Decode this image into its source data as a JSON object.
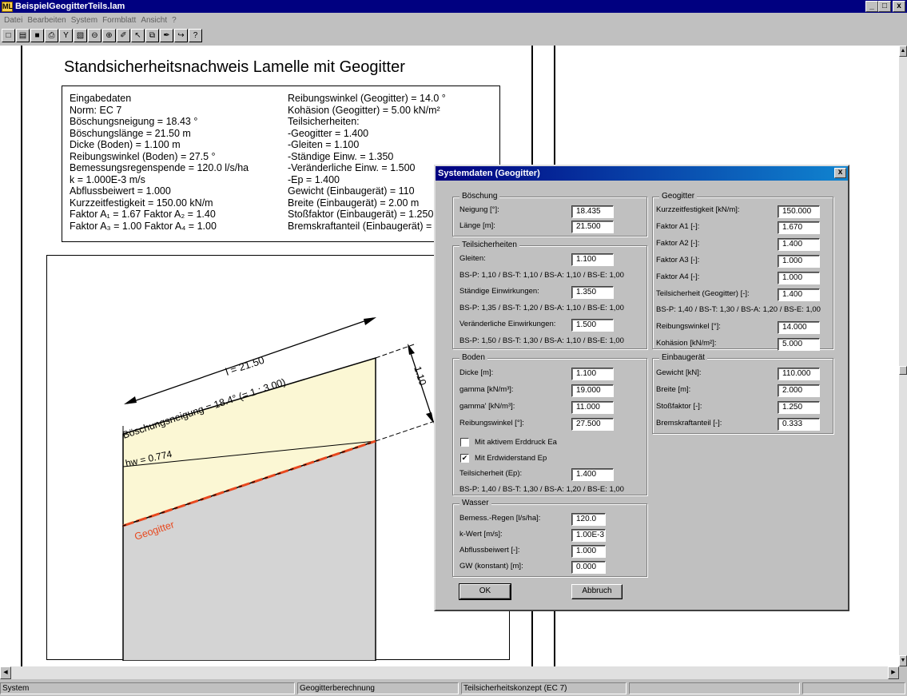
{
  "window": {
    "title": "BeispielGeogitterTeils.lam",
    "app_icon": "ML",
    "controls": [
      "_",
      "□",
      "x"
    ]
  },
  "menu": [
    "Datei",
    "Bearbeiten",
    "System",
    "Formblatt",
    "Ansicht",
    "?"
  ],
  "toolbar": [
    "new-icon",
    "open-icon",
    "save-icon",
    "print-icon",
    "filter-icon",
    "page-preview-icon",
    "zoom-out-icon",
    "zoom-in-icon",
    "edit-icon",
    "pointer-icon",
    "copy-icon",
    "paint-icon",
    "export-icon",
    "help-icon"
  ],
  "toolbar_glyphs": [
    "□",
    "▤",
    "■",
    "⎙",
    "Y",
    "▧",
    "⊖",
    "⊕",
    "✐",
    "↖",
    "⧉",
    "✒",
    "↪",
    "?"
  ],
  "document": {
    "title": "Standsicherheitsnachweis Lamelle mit Geogitter",
    "left_lines": [
      "Eingabedaten",
      "Norm:  EC 7",
      "Böschungsneigung  = 18.43 °",
      "Böschungslänge  = 21.50 m",
      "Dicke (Boden)  = 1.100 m",
      "Reibungswinkel (Boden) = 27.5 °",
      "Bemessungsregenspende = 120.0 l/s/ha",
      "k  =  1.000E-3 m/s",
      "Abflussbeiwert = 1.000",
      "Kurzzeitfestigkeit = 150.00 kN/m",
      "Faktor A₁ = 1.67  Faktor A₂ = 1.40",
      "Faktor A₃ = 1.00  Faktor A₄ = 1.00"
    ],
    "right_lines": [
      "Reibungswinkel (Geogitter) = 14.0 °",
      "Kohäsion (Geogitter) = 5.00 kN/m²",
      "Teilsicherheiten:",
      " -Geogitter = 1.400",
      " -Gleiten = 1.100",
      " -Ständige Einw. = 1.350",
      " -Veränderliche Einw. = 1.500",
      " -Ep = 1.400",
      "Gewicht (Einbaugerät) = 110",
      "Breite (Einbaugerät) = 2.00 m",
      "Stoßfaktor (Einbaugerät) = 1.250",
      "Bremskraftanteil (Einbaugerät) = 0.333"
    ],
    "drawing": {
      "length_label": "l = 21.50",
      "slope_label": "Böschungsneigung = 18.4° (= 1 : 3.00)",
      "thickness_label": "1.10",
      "hw_label": "hw = 0.774",
      "geogitter_label": "Geogitter",
      "colors": {
        "soil": "#fbf7d4",
        "base": "#d4d4d4",
        "geogitter": "#e8481e"
      }
    }
  },
  "dialog": {
    "title": "Systemdaten (Geogitter)",
    "close": "x",
    "boeschung": {
      "title": "Böschung",
      "neigung_label": "Neigung [°]:",
      "neigung": "18.435",
      "laenge_label": "Länge [m]:",
      "laenge": "21.500"
    },
    "teilsicherheiten": {
      "title": "Teilsicherheiten",
      "gleiten_label": "Gleiten:",
      "gleiten": "1.100",
      "gleiten_note": "BS-P: 1,10 / BS-T: 1,10 / BS-A: 1,10 / BS-E: 1,00",
      "staendig_label": "Ständige Einwirkungen:",
      "staendig": "1.350",
      "staendig_note": "BS-P: 1,35 / BS-T: 1,20 / BS-A: 1,10 / BS-E: 1,00",
      "veraenderlich_label": "Veränderliche Einwirkungen:",
      "veraenderlich": "1.500",
      "veraenderlich_note": "BS-P: 1,50 / BS-T: 1,30 / BS-A: 1,10 / BS-E: 1,00"
    },
    "boden": {
      "title": "Boden",
      "dicke_label": "Dicke [m]:",
      "dicke": "1.100",
      "gamma_label": "gamma [kN/m³]:",
      "gamma": "19.000",
      "gamma2_label": "gamma' [kN/m³]:",
      "gamma2": "11.000",
      "reibung_label": "Reibungswinkel [°]:",
      "reibung": "27.500",
      "aktiv_label": "Mit aktivem Erddruck Ea",
      "aktiv_checked": false,
      "widerstand_label": "Mit Erdwiderstand Ep",
      "widerstand_checked": true,
      "teilsicherheit_label": "Teilsicherheit (Ep):",
      "teilsicherheit": "1.400",
      "note": "BS-P: 1,40 / BS-T: 1,30 / BS-A: 1,20 / BS-E: 1,00"
    },
    "wasser": {
      "title": "Wasser",
      "regen_label": "Bemess.-Regen [l/s/ha]:",
      "regen": "120.0",
      "kwert_label": "k-Wert [m/s]:",
      "kwert": "1.00E-3",
      "abfluss_label": "Abflussbeiwert [-]:",
      "abfluss": "1.000",
      "gw_label": "GW (konstant) [m]:",
      "gw": "0.000"
    },
    "geogitter": {
      "title": "Geogitter",
      "kurzzeit_label": "Kurzzeitfestigkeit [kN/m]:",
      "kurzzeit": "150.000",
      "a1_label": "Faktor A1 [-]:",
      "a1": "1.670",
      "a2_label": "Faktor A2 [-]:",
      "a2": "1.400",
      "a3_label": "Faktor A3 [-]:",
      "a3": "1.000",
      "a4_label": "Faktor A4 [-]:",
      "a4": "1.000",
      "ts_label": "Teilsicherheit (Geogitter) [-]:",
      "ts": "1.400",
      "ts_note": "BS-P: 1,40 / BS-T: 1,30 / BS-A: 1,20 / BS-E: 1,00",
      "reibung_label": "Reibungswinkel [°]:",
      "reibung": "14.000",
      "kohaesion_label": "Kohäsion [kN/m²]:",
      "kohaesion": "5.000"
    },
    "einbaugeraet": {
      "title": "Einbaugerät",
      "gewicht_label": "Gewicht [kN]:",
      "gewicht": "110.000",
      "breite_label": "Breite [m]:",
      "breite": "2.000",
      "stoss_label": "Stoßfaktor [-]:",
      "stoss": "1.250",
      "brems_label": "Bremskraftanteil [-]:",
      "brems": "0.333"
    },
    "ok_label": "OK",
    "cancel_label": "Abbruch"
  },
  "status": [
    "System",
    "Geogitterberechnung",
    "Teilsicherheitskonzept (EC 7)"
  ],
  "scroll": {
    "up": "▲",
    "down": "▼",
    "left": "◀",
    "right": "▶"
  }
}
